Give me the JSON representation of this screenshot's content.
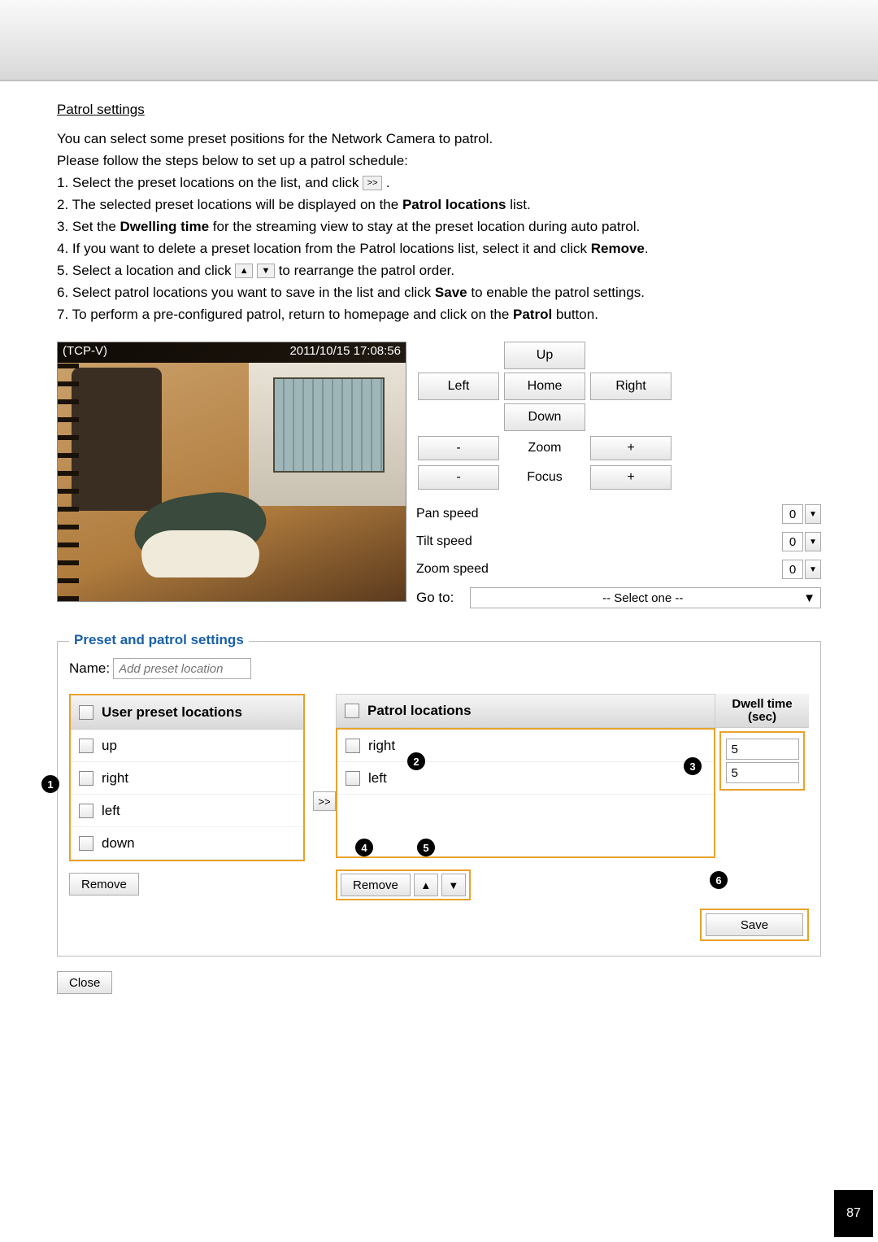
{
  "page_number": "87",
  "section_title": "Patrol settings",
  "intro_lines": [
    "You can select some preset positions for the Network Camera to patrol.",
    "Please follow the steps below to set up a patrol schedule:"
  ],
  "steps": {
    "s1a": "1. Select the preset locations on the list, and click ",
    "s1b": " .",
    "s2a": "2. The selected preset locations will be displayed on the ",
    "s2b": "Patrol locations",
    "s2c": " list.",
    "s3a": "3. Set the ",
    "s3b": "Dwelling time",
    "s3c": " for the streaming view to stay at the preset location during auto patrol.",
    "s4a": "4. If you want to delete a preset location from the Patrol locations list, select it and click ",
    "s4b": "Remove",
    "s4c": ".",
    "s5a": "5. Select a location and click ",
    "s5b": " to rearrange the patrol order.",
    "s6a": "6. Select patrol locations you want to save in the list and click ",
    "s6b": "Save",
    "s6c": " to enable the patrol settings.",
    "s7a": "7. To perform a pre-configured patrol, return to homepage and click on the ",
    "s7b": "Patrol",
    "s7c": " button."
  },
  "inline_icons": {
    "transfer": ">>",
    "up": "▲",
    "down": "▼"
  },
  "video": {
    "source": "(TCP-V)",
    "timestamp": "2011/10/15  17:08:56"
  },
  "ptz": {
    "up": "Up",
    "down": "Down",
    "left": "Left",
    "right": "Right",
    "home": "Home",
    "zoom_label": "Zoom",
    "focus_label": "Focus",
    "minus": "-",
    "plus": "+",
    "pan_speed": "Pan speed",
    "tilt_speed": "Tilt speed",
    "zoom_speed": "Zoom speed",
    "speed_value": "0",
    "goto": "Go to:",
    "goto_value": "-- Select one --"
  },
  "fieldset_title": "Preset and patrol settings",
  "name_label": "Name:",
  "name_placeholder": "Add preset location",
  "preset_header": "User preset locations",
  "preset_items": [
    "up",
    "right",
    "left",
    "down"
  ],
  "patrol_header": "Patrol locations",
  "dwell_header_1": "Dwell time",
  "dwell_header_2": "(sec)",
  "patrol_items": [
    {
      "name": "right",
      "dwell": "5"
    },
    {
      "name": "left",
      "dwell": "5"
    }
  ],
  "transfer_btn": ">>",
  "remove_btn": "Remove",
  "save_btn": "Save",
  "close_btn": "Close",
  "arrow_up": "▲",
  "arrow_down": "▼",
  "callouts": {
    "c1": "1",
    "c2": "2",
    "c3": "3",
    "c4": "4",
    "c5": "5",
    "c6": "6"
  }
}
